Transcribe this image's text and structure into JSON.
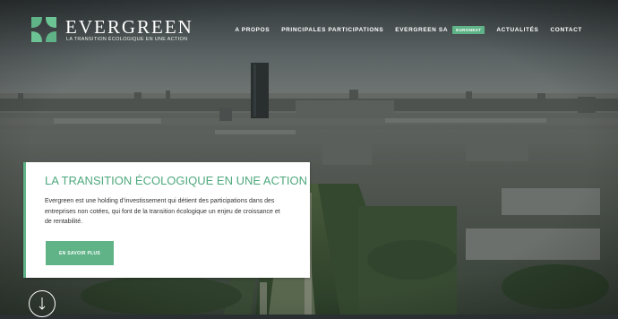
{
  "brand": {
    "name": "EVERGREEN",
    "tagline": "LA TRANSITION ÉCOLOGIQUE EN UNE ACTION",
    "accent": "#5fb387"
  },
  "nav": {
    "items": [
      {
        "label": "A PROPOS"
      },
      {
        "label": "PRINCIPALES PARTICIPATIONS"
      },
      {
        "label": "EVERGREEN SA",
        "badge": "EURONEXT"
      },
      {
        "label": "ACTUALITÉS"
      },
      {
        "label": "CONTACT"
      }
    ]
  },
  "hero": {
    "title": "LA TRANSITION ÉCOLOGIQUE EN UNE ACTION",
    "text": "Evergreen est une holding d’investissement qui détient des participations dans des entreprises non cotées, qui font de la transition écologique un enjeu de croissance et de rentabilité.",
    "button_label": "EN SAVOIR PLUS",
    "scroll_icon": "arrow-down-icon"
  }
}
